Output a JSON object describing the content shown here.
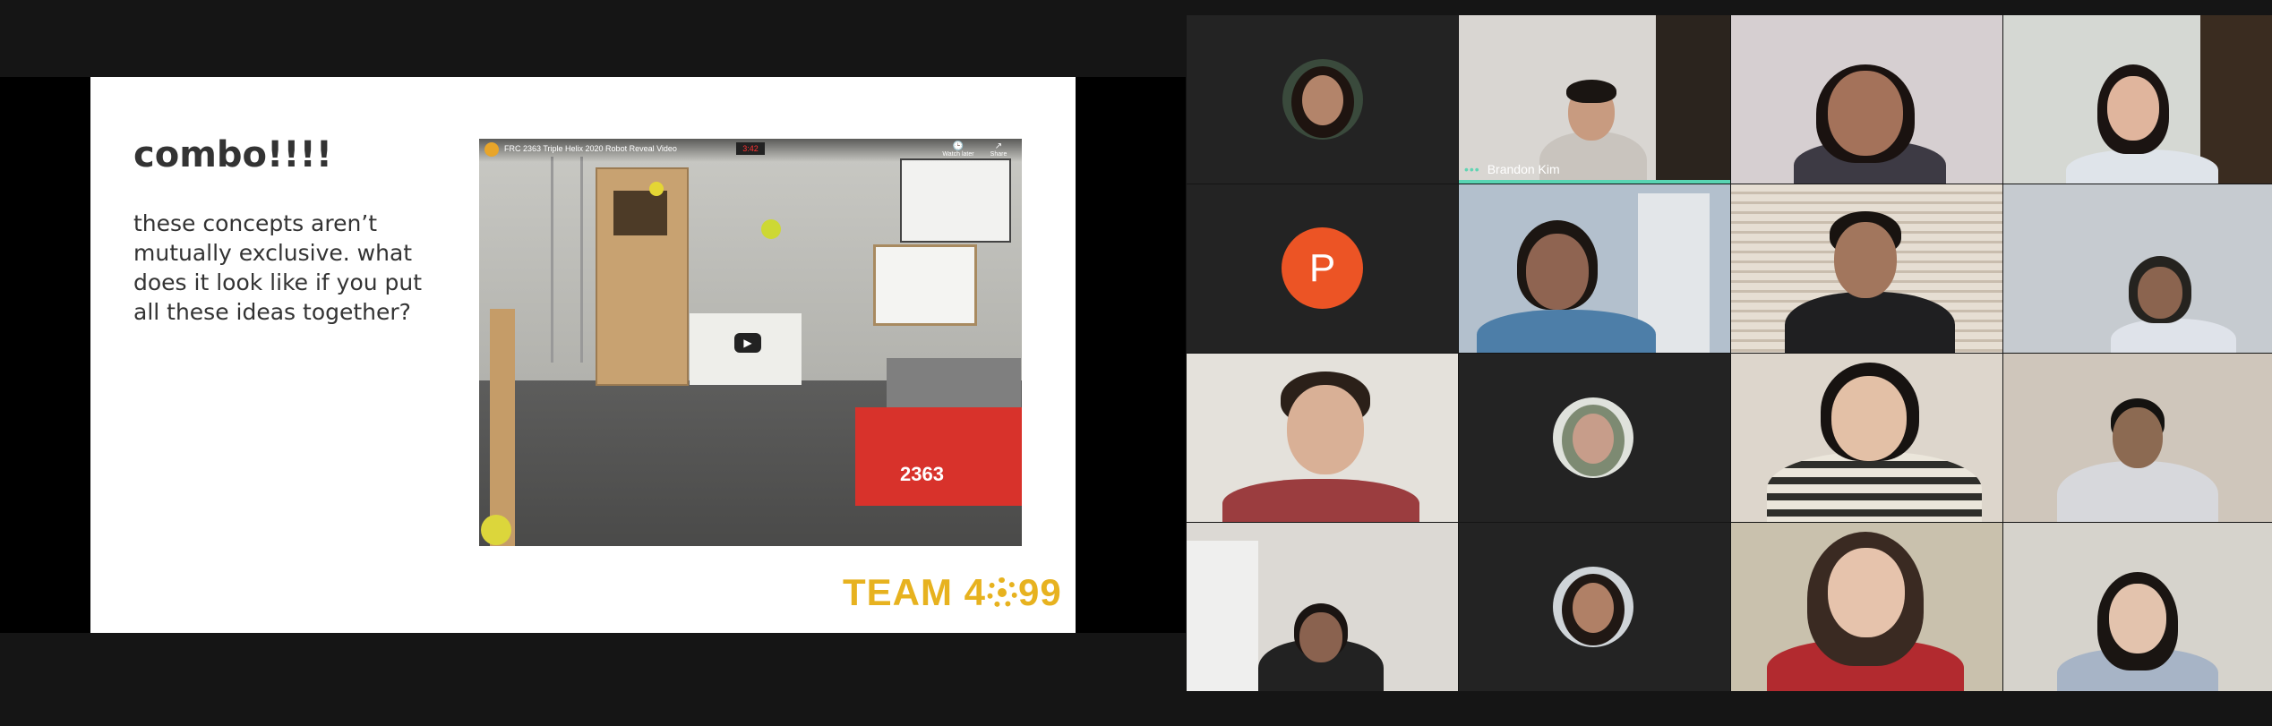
{
  "slide": {
    "title": "combo!!!!",
    "body": "these concepts aren’t mutually exclusive. what does it look like if you put all these ideas together?",
    "video": {
      "title": "FRC 2363 Triple Helix 2020 Robot Reveal Video",
      "clock": "3:42",
      "watch_later": "Watch later",
      "share": "Share",
      "robot_number": "2363",
      "play_icon": "play-icon"
    },
    "logo_prefix": "TEAM 4",
    "logo_suffix": "99"
  },
  "participants": {
    "speaker_name": "Brandon Kim",
    "avatar_letter": "P",
    "speaking_color": "#59d4b3"
  }
}
